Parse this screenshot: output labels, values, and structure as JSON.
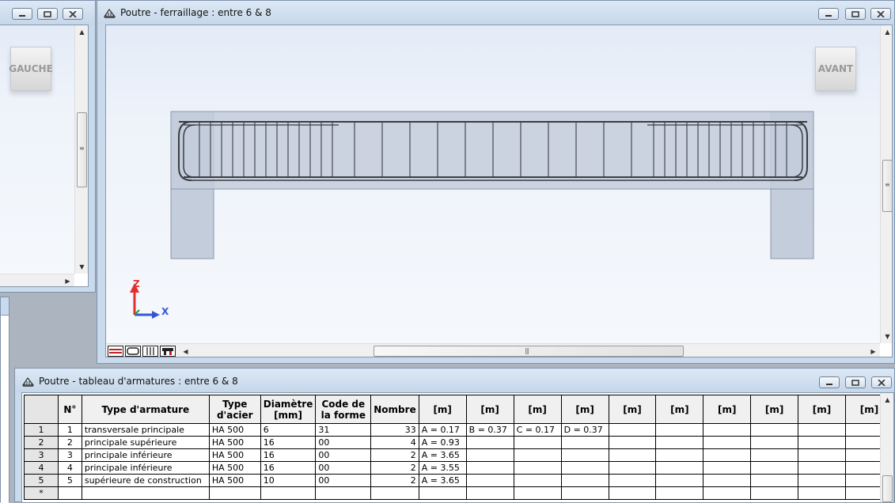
{
  "colors": {
    "beam_fill": "#c4cddc",
    "beam_stroke": "#8c97a8",
    "rebar": "#3a3d42",
    "axis_z": "#e23030",
    "axis_y": "#2c9c2c",
    "axis_x": "#3356d6"
  },
  "left_panel": {
    "nav_label": "GAUCHE"
  },
  "main_window": {
    "title": "Poutre - ferraillage : entre 6 & 8",
    "nav_label": "AVANT",
    "axis_z": "Z",
    "axis_x": "X",
    "view_tools": [
      "rebar-view-1-icon",
      "rebar-view-2-icon",
      "rebar-view-3-icon",
      "rebar-view-4-icon"
    ]
  },
  "table_window": {
    "title": "Poutre - tableau d'armatures : entre 6 & 8",
    "headers": [
      "N°",
      "Type d'armature",
      "Type d'acier",
      "Diamètre [mm]",
      "Code de la forme",
      "Nombre",
      "[m]",
      "[m]",
      "[m]",
      "[m]",
      "[m]",
      "[m]",
      "[m]",
      "[m]",
      "[m]",
      "[m]"
    ],
    "rows": [
      {
        "row": "1",
        "n": "1",
        "type": "transversale principale",
        "acier": "HA 500",
        "diam": "6",
        "code": "31",
        "nombre": "33",
        "m1": "A = 0.17",
        "m2": "B = 0.37",
        "m3": "C = 0.17",
        "m4": "D = 0.37"
      },
      {
        "row": "2",
        "n": "2",
        "type": "principale supérieure",
        "acier": "HA 500",
        "diam": "16",
        "code": "00",
        "nombre": "4",
        "m1": "A = 0.93",
        "m2": "",
        "m3": "",
        "m4": ""
      },
      {
        "row": "3",
        "n": "3",
        "type": "principale inférieure",
        "acier": "HA 500",
        "diam": "16",
        "code": "00",
        "nombre": "2",
        "m1": "A = 3.65",
        "m2": "",
        "m3": "",
        "m4": ""
      },
      {
        "row": "4",
        "n": "4",
        "type": "principale inférieure",
        "acier": "HA 500",
        "diam": "16",
        "code": "00",
        "nombre": "2",
        "m1": "A = 3.55",
        "m2": "",
        "m3": "",
        "m4": ""
      },
      {
        "row": "5",
        "n": "5",
        "type": "supérieure de construction",
        "acier": "HA 500",
        "diam": "10",
        "code": "00",
        "nombre": "2",
        "m1": "A = 3.65",
        "m2": "",
        "m3": "",
        "m4": ""
      }
    ],
    "new_row_marker": "*"
  }
}
